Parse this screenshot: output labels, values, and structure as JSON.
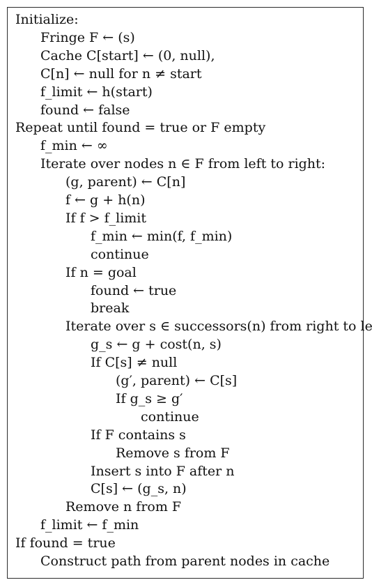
{
  "algorithm": {
    "lines": [
      {
        "indent": 0,
        "text": "Initialize:"
      },
      {
        "indent": 1,
        "text": "Fringe F ← (s)"
      },
      {
        "indent": 1,
        "text": "Cache C[start] ← (0, null),"
      },
      {
        "indent": 1,
        "text": "C[n] ← null for n ≠ start"
      },
      {
        "indent": 1,
        "text": "f_limit ← h(start)"
      },
      {
        "indent": 1,
        "text": "found ← false"
      },
      {
        "indent": 0,
        "text": "Repeat until found = true or F empty"
      },
      {
        "indent": 1,
        "text": "f_min ← ∞"
      },
      {
        "indent": 1,
        "text": "Iterate over nodes n ∈ F from left to right:"
      },
      {
        "indent": 2,
        "text": "(g, parent) ← C[n]"
      },
      {
        "indent": 2,
        "text": "f ← g + h(n)"
      },
      {
        "indent": 2,
        "text": "If f > f_limit"
      },
      {
        "indent": 3,
        "text": "f_min ← min(f, f_min)"
      },
      {
        "indent": 3,
        "text": "continue"
      },
      {
        "indent": 2,
        "text": "If n = goal"
      },
      {
        "indent": 3,
        "text": "found ← true"
      },
      {
        "indent": 3,
        "text": "break"
      },
      {
        "indent": 2,
        "text": "Iterate over s ∈ successors(n) from right to left:"
      },
      {
        "indent": 3,
        "text": "g_s ← g + cost(n, s)"
      },
      {
        "indent": 3,
        "text": "If C[s] ≠ null"
      },
      {
        "indent": 4,
        "text": "(g′, parent) ← C[s]"
      },
      {
        "indent": 4,
        "text": "If g_s ≥ g′"
      },
      {
        "indent": 5,
        "text": "continue"
      },
      {
        "indent": 3,
        "text": "If F contains s"
      },
      {
        "indent": 4,
        "text": "Remove s from F"
      },
      {
        "indent": 3,
        "text": "Insert s into F after n"
      },
      {
        "indent": 3,
        "text": "C[s] ← (g_s, n)"
      },
      {
        "indent": 2,
        "text": "Remove n from F"
      },
      {
        "indent": 1,
        "text": "f_limit ← f_min"
      },
      {
        "indent": 0,
        "text": "If found = true"
      },
      {
        "indent": 1,
        "text": "Construct path from parent nodes in cache"
      }
    ]
  }
}
